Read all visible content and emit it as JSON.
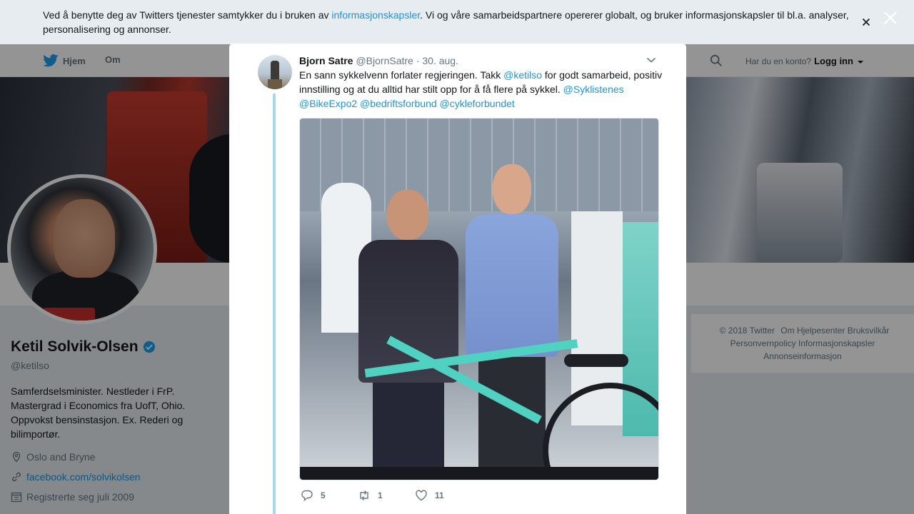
{
  "nav": {
    "home_label": "Hjem",
    "about_label": "Om",
    "login_prompt": "Har du en konto?",
    "login_label": "Logg inn"
  },
  "profile": {
    "name": "Ketil Solvik-Olsen",
    "handle": "@ketilso",
    "bio": "Samferdselsminister. Nestleder i FrP. Mastergrad i Economics fra UofT, Ohio. Oppvokst bensinstasjon. Ex. Rederi og bilimportør.",
    "location": "Oslo and Bryne",
    "website": "facebook.com/solvikolsen",
    "joined": "Registrerte seg juli 2009"
  },
  "footer": {
    "items": [
      "© 2018 Twitter",
      "Om",
      "Hjelpesenter",
      "Bruksvilkår",
      "Personvernpolicy",
      "Informasjonskapsler",
      "Annonseinformasjon"
    ]
  },
  "cookie_banner": {
    "text_before": "Ved å benytte deg av Twitters tjenester samtykker du i bruken av ",
    "link_text": "informasjonskapsler",
    "text_after": ". Vi og våre samarbeidspartnere opererer globalt, og bruker informasjonskapsler til bl.a. analyser, personalisering og annonser."
  },
  "tweet": {
    "author_name": "Bjorn Satre",
    "author_handle": "@BjornSatre",
    "date": "· 30. aug.",
    "text_1": "En sann sykkelvenn forlater regjeringen. Takk ",
    "mention_1": "@ketilso",
    "text_2": " for godt samarbeid, positiv innstilling og at du alltid har stilt opp for å få flere på sykkel. ",
    "mention_2": "@Syklistenes",
    "mention_3": "@BikeExpo2",
    "mention_4": "@bedriftsforbund",
    "mention_5": "@cykleforbundet",
    "reply_count": "5",
    "retweet_count": "1",
    "like_count": "11"
  },
  "colors": {
    "accent": "#1b95e0",
    "thread_line": "#a6d7ec",
    "verified": "#1da1f2"
  },
  "icons": [
    "twitter-bird-icon",
    "search-icon",
    "verified-icon",
    "location-icon",
    "link-icon",
    "calendar-icon",
    "close-icon",
    "chevron-down-icon",
    "reply-icon",
    "retweet-icon",
    "like-icon"
  ]
}
